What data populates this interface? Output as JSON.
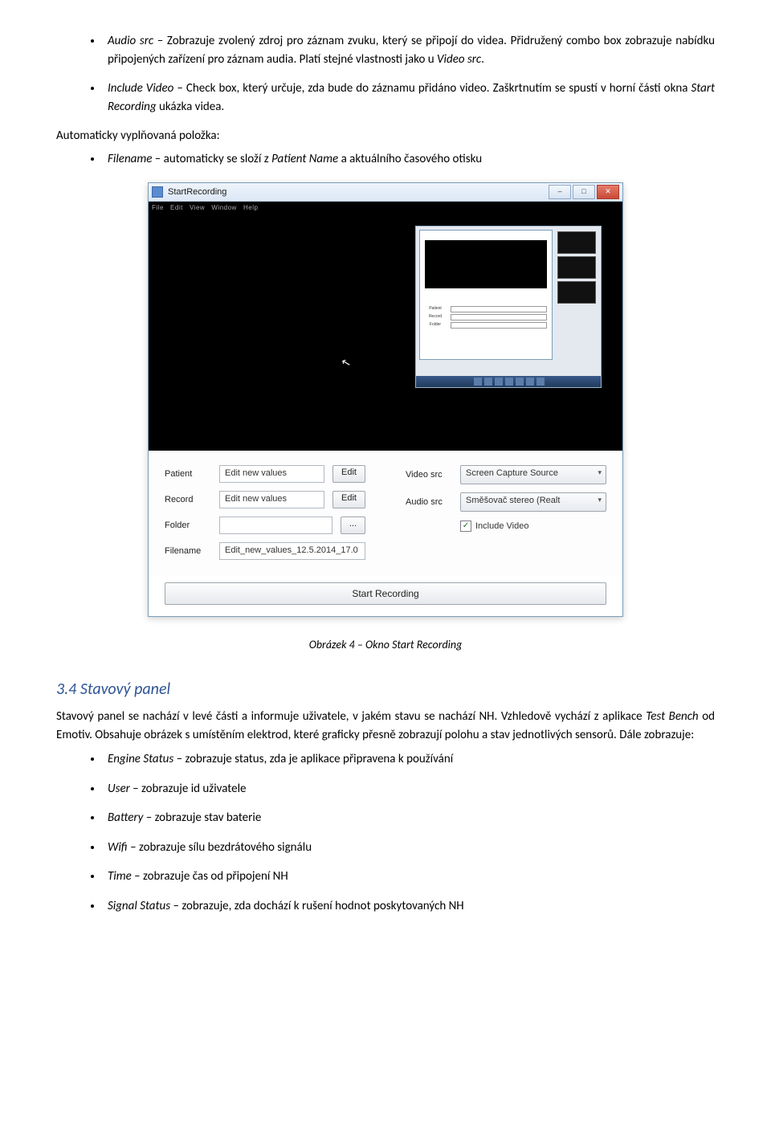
{
  "bullets_top": [
    {
      "term": "Audio src",
      "rest": " – Zobrazuje zvolený zdroj pro záznam zvuku, který se připojí do videa. Přidružený combo box zobrazuje nabídku připojených zařízení pro záznam audia. Platí stejné vlastnosti jako u ",
      "tail_italic": "Video src",
      "tail_plain": "."
    },
    {
      "term": "Include Video",
      "rest": " – Check box, který určuje, zda bude do záznamu přidáno video. Zaškrtnutím se spustí v horní části okna ",
      "tail_italic": "Start Recording",
      "tail_plain": " ukázka videa."
    }
  ],
  "auto_label": "Automaticky vyplňovaná položka:",
  "bullets_auto": [
    {
      "term": "Filename",
      "rest": " – automaticky se složí z ",
      "tail_italic": "Patient Name",
      "tail_plain": " a aktuálního časového otisku"
    }
  ],
  "screenshot": {
    "title": "StartRecording",
    "left": {
      "patient_label": "Patient",
      "patient_value": "Edit new values",
      "edit_btn": "Edit",
      "record_label": "Record",
      "record_value": "Edit new values",
      "folder_label": "Folder",
      "folder_btn": "...",
      "filename_label": "Filename",
      "filename_value": "Edit_new_values_12.5.2014_17.0"
    },
    "right": {
      "videosrc_label": "Video src",
      "videosrc_value": "Screen Capture Source",
      "audiosrc_label": "Audio src",
      "audiosrc_value": "Směšovač stereo (Realt",
      "include_label": "Include Video",
      "include_checked": "✓"
    },
    "start_button": "Start Recording"
  },
  "caption": "Obrázek 4 – Okno Start Recording",
  "section_heading": "3.4   Stavový panel",
  "section_para": {
    "p1": "Stavový panel se nachází v levé části a informuje uživatele, v jakém stavu se nachází NH. Vzhledově vychází z aplikace ",
    "i1": "Test Bench",
    "p2": " od Emotiv. Obsahuje obrázek s umístěním elektrod, které graficky přesně zobrazují polohu a stav jednotlivých sensorů. Dále zobrazuje:"
  },
  "bullets_bottom": [
    {
      "term": "Engine Status",
      "rest": " – zobrazuje status, zda je aplikace připravena k používání"
    },
    {
      "term": "User",
      "rest": " – zobrazuje id uživatele"
    },
    {
      "term": "Battery",
      "rest": " – zobrazuje stav baterie"
    },
    {
      "term": "Wifi",
      "rest": " – zobrazuje sílu bezdrátového signálu"
    },
    {
      "term": "Time",
      "rest": " – zobrazuje čas od připojení NH"
    },
    {
      "term": "Signal Status",
      "rest": " – zobrazuje, zda dochází k rušení hodnot poskytovaných NH"
    }
  ]
}
